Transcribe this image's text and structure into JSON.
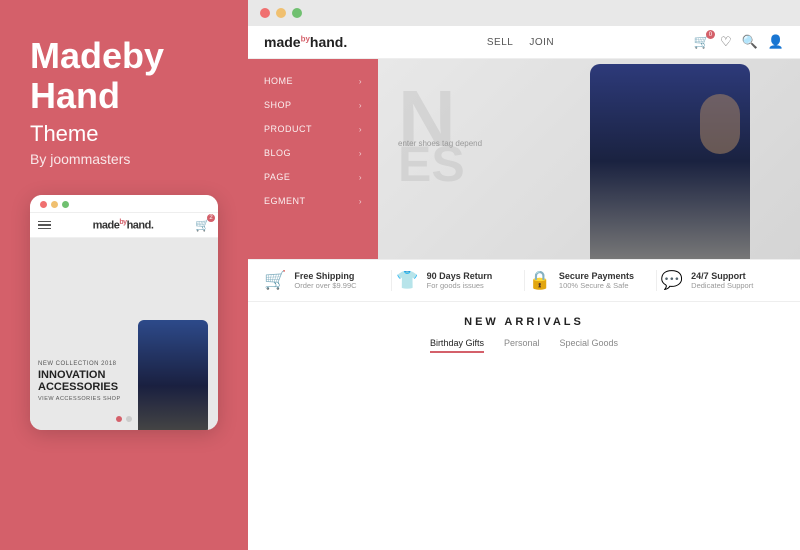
{
  "leftPanel": {
    "brandTitle": "Madeby Hand",
    "subtitle": "Theme",
    "byText": "By joommasters",
    "phoneDots": [
      "red",
      "yellow",
      "green"
    ],
    "phoneNav": {
      "logoText": "made",
      "logoSup": "by",
      "logoEnd": "hand."
    },
    "heroLabel": "NEW COLLECTION 2018",
    "heroTitle1": "INNOVATION",
    "heroTitle2": "ACCESSORIES",
    "heroLink": "VIEW ACCESSORIES SHOP"
  },
  "browser": {
    "dots": [
      "red",
      "yellow",
      "green"
    ]
  },
  "siteHeader": {
    "logoText": "made",
    "logoSup": "by",
    "logoEnd": "hand.",
    "nav": [
      {
        "label": "SELL"
      },
      {
        "label": "JOIN"
      }
    ]
  },
  "sidebarMenu": {
    "items": [
      {
        "label": "HOME"
      },
      {
        "label": "SHOP"
      },
      {
        "label": "PRODUCT"
      },
      {
        "label": "BLOG"
      },
      {
        "label": "PAGE"
      },
      {
        "label": "EGMENT"
      }
    ]
  },
  "hero": {
    "tagline": "enter shoes tag depend"
  },
  "features": [
    {
      "icon": "🛒",
      "title": "Free Shipping",
      "desc": "Order over $9.99C"
    },
    {
      "icon": "👕",
      "title": "90 Days Return",
      "desc": "For goods issues"
    },
    {
      "icon": "🔒",
      "title": "Secure Payments",
      "desc": "100% Secure & Safe"
    },
    {
      "icon": "💬",
      "title": "24/7 Support",
      "desc": "Dedicated Support"
    }
  ],
  "newArrivals": {
    "title": "NEW ARRIVALS",
    "tabs": [
      {
        "label": "Birthday Gifts",
        "active": true
      },
      {
        "label": "Personal",
        "active": false
      },
      {
        "label": "Special Goods",
        "active": false
      }
    ]
  }
}
